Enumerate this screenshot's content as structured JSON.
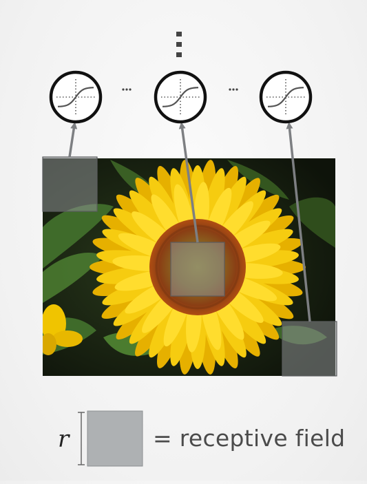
{
  "diagram": {
    "units": {
      "count_shown": 3,
      "between_marker": "···",
      "above_marker": "⋮"
    },
    "receptive_fields": {
      "count": 3
    },
    "legend": {
      "symbol": "r",
      "equals_text": "= receptive field"
    },
    "colors": {
      "arrow": "#7d7f82",
      "circle_stroke": "#111111",
      "sigmoid": "#555555",
      "axis_dotted": "#555555",
      "overlay_fill": "#8e9193",
      "legend_box": "#aeb1b3"
    },
    "icons": {
      "unit": "sigmoid-neuron-icon",
      "image": "sunflower-photo"
    }
  }
}
